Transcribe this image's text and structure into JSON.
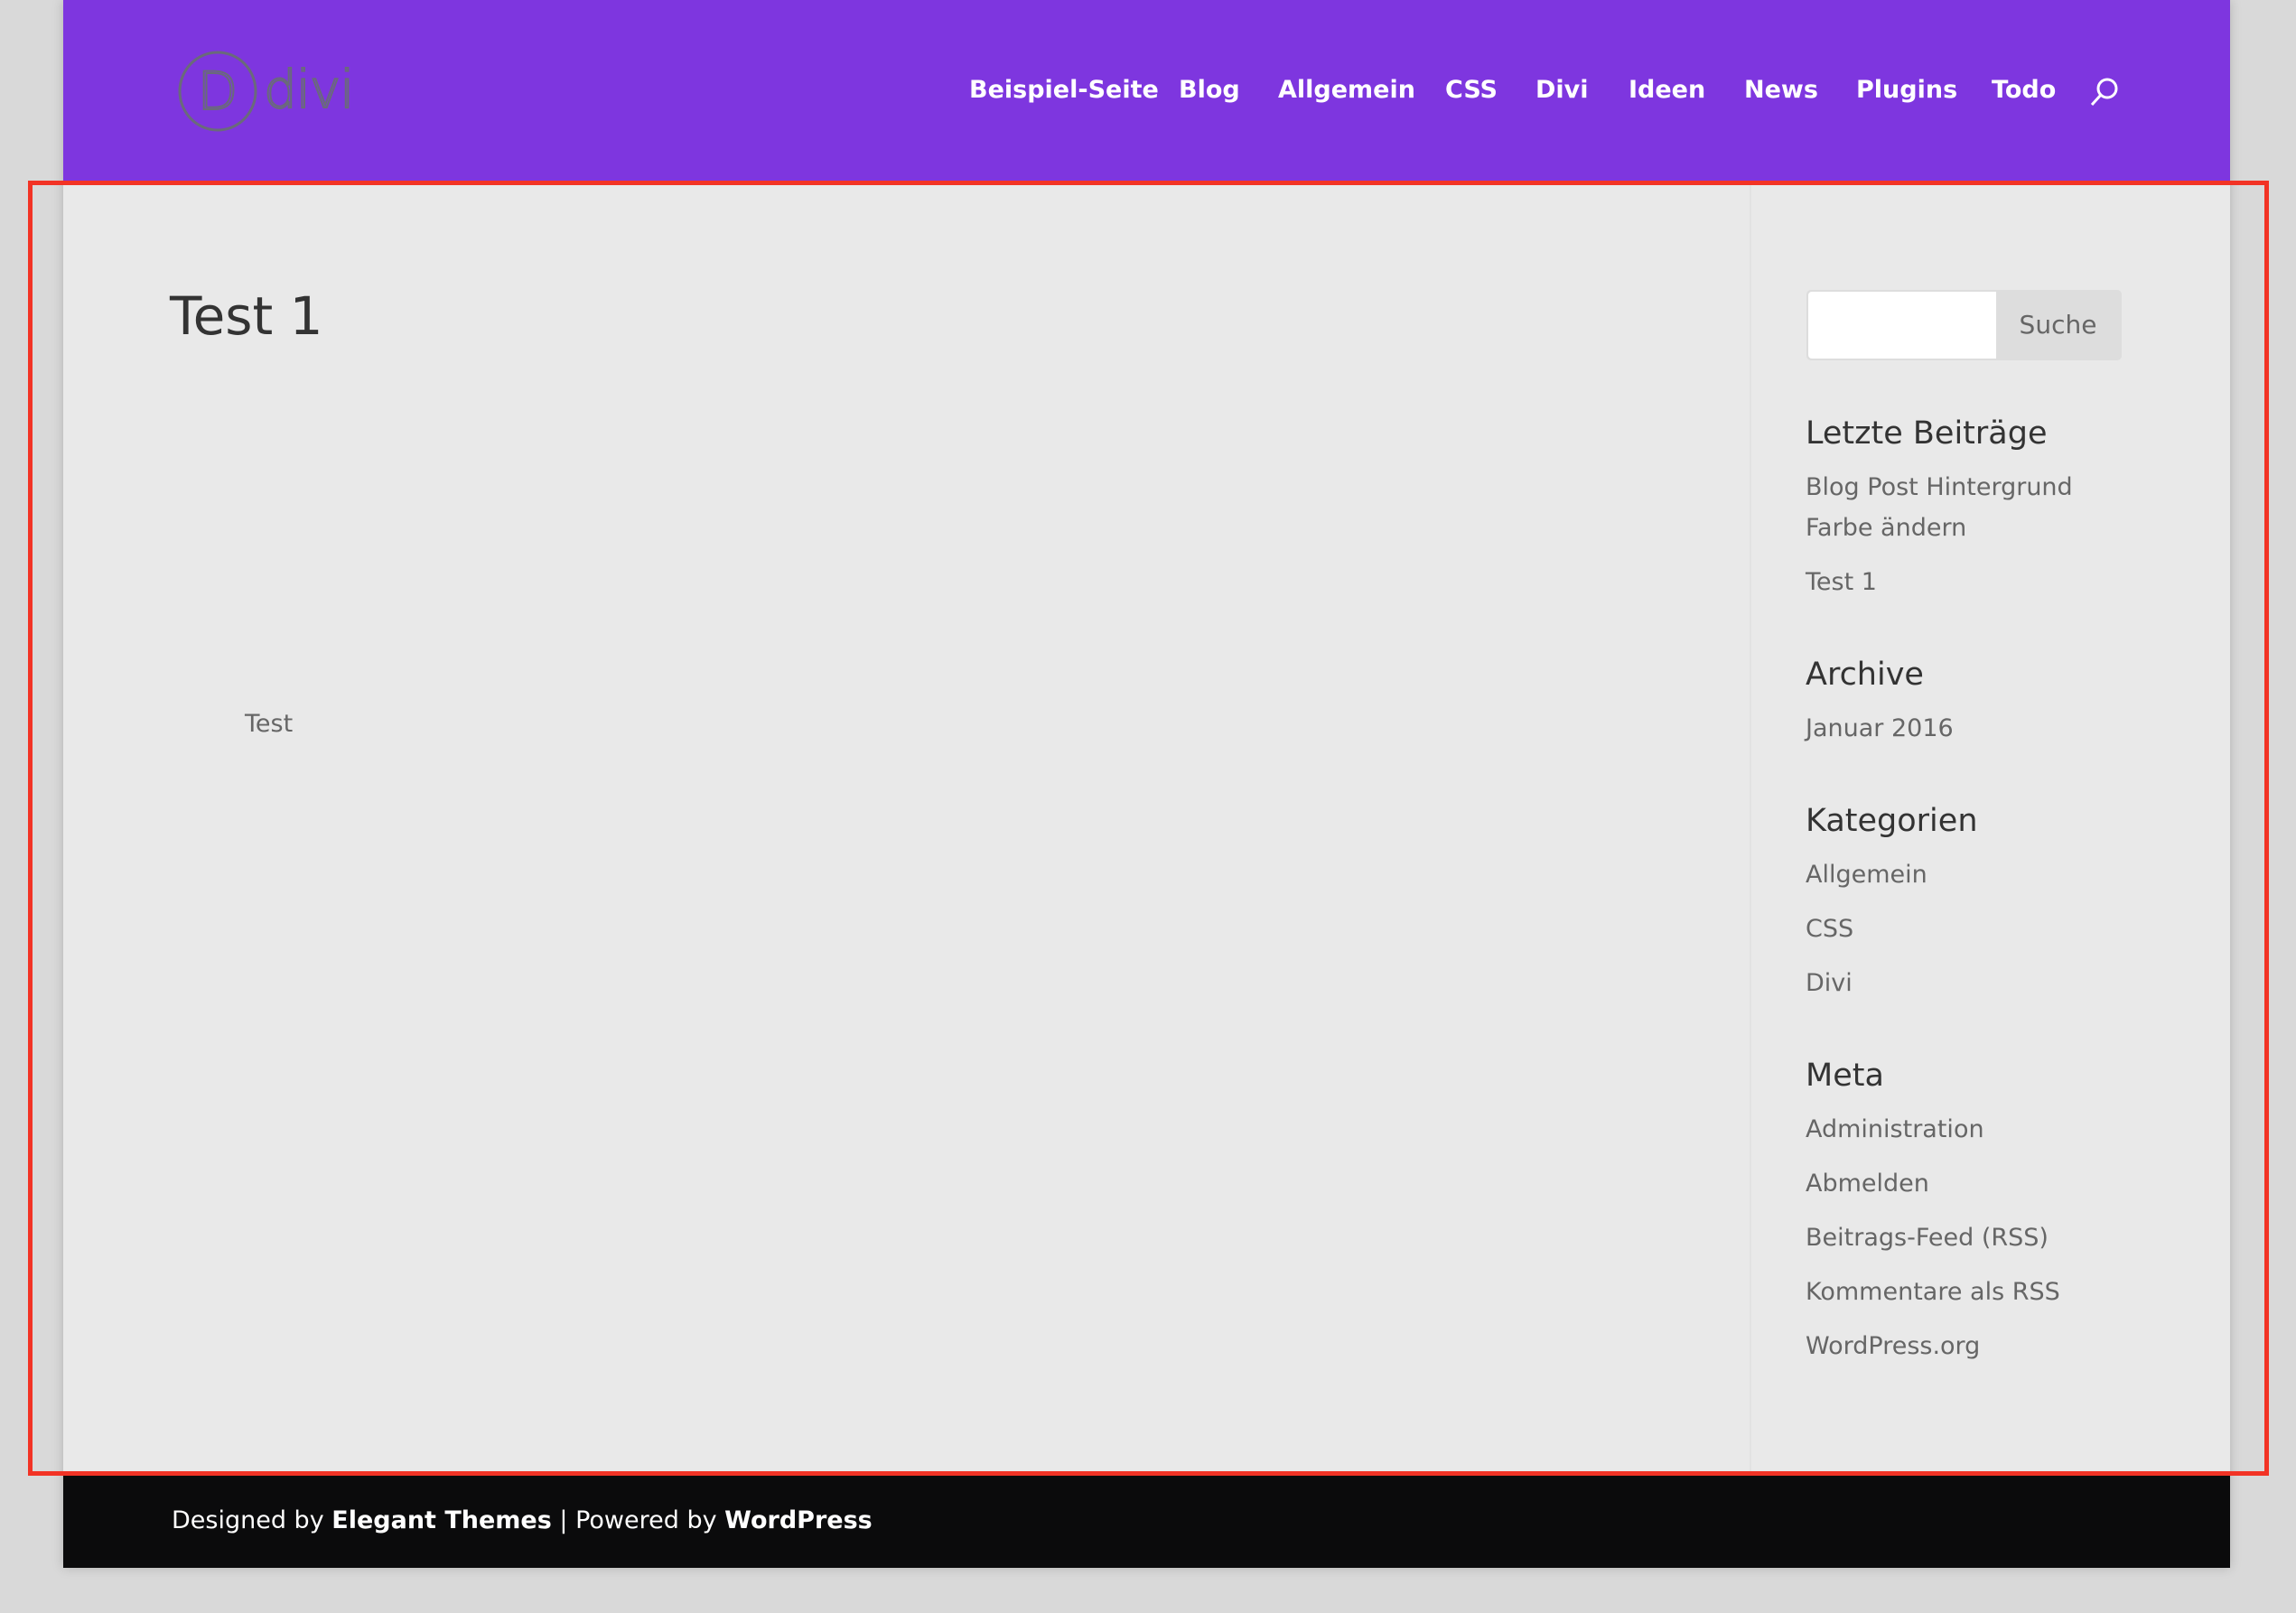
{
  "header": {
    "logo_text": "divi",
    "nav": [
      "Beispiel-Seite",
      "Blog",
      "Allgemein",
      "CSS",
      "Divi",
      "Ideen",
      "News",
      "Plugins",
      "Todo"
    ],
    "search_icon": "search-icon",
    "color": "#7e36df"
  },
  "main": {
    "title": "Test 1",
    "body": "Test"
  },
  "sidebar": {
    "search": {
      "value": "",
      "button": "Suche"
    },
    "recent": {
      "title": "Letzte Beiträge",
      "items": [
        "Blog Post Hintergrund",
        "Farbe ändern",
        "Test 1"
      ]
    },
    "archive": {
      "title": "Archive",
      "items": [
        "Januar 2016"
      ]
    },
    "categories": {
      "title": "Kategorien",
      "items": [
        "Allgemein",
        "CSS",
        "Divi"
      ]
    },
    "meta": {
      "title": "Meta",
      "items": [
        "Administration",
        "Abmelden",
        "Beitrags-Feed (RSS)",
        "Kommentare als RSS",
        "WordPress.org"
      ]
    }
  },
  "footer": {
    "designed_by": "Designed by ",
    "elegant": "Elegant Themes",
    "sep": " | Powered by ",
    "wordpress": "WordPress"
  },
  "highlight_color": "#f23325"
}
